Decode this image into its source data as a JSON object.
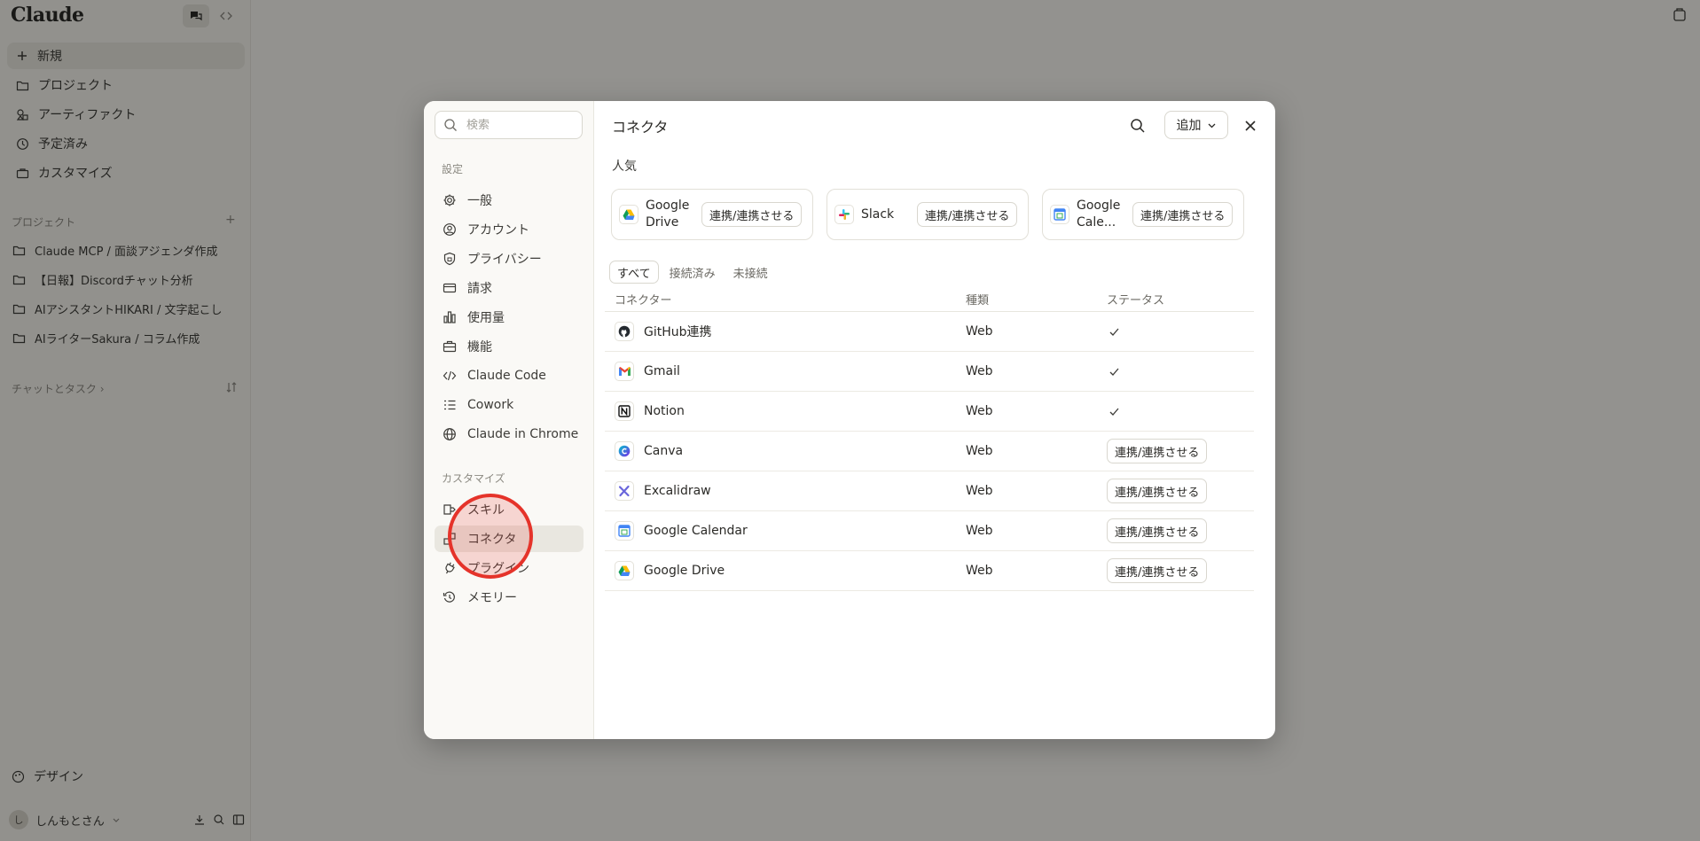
{
  "app": {
    "logo": "Claude",
    "nav": [
      {
        "label": "新規",
        "icon": "plus-icon"
      },
      {
        "label": "プロジェクト",
        "icon": "folder-icon"
      },
      {
        "label": "アーティファクト",
        "icon": "artifact-icon"
      },
      {
        "label": "予定済み",
        "icon": "clock-icon"
      },
      {
        "label": "カスタマイズ",
        "icon": "briefcase-icon"
      }
    ],
    "projects_label": "プロジェクト",
    "projects": [
      "Claude MCP / 面談アジェンダ作成",
      "【日報】Discordチャット分析",
      "AIアシスタントHIKARI / 文字起こし",
      "AIライターSakura / コラム作成"
    ],
    "chats_label": "チャットとタスク ›",
    "design_label": "デザイン",
    "user_name": "しんもとさん"
  },
  "modal": {
    "search_placeholder": "検索",
    "settings_label": "設定",
    "settings_items": [
      {
        "label": "一般",
        "icon": "gear-icon"
      },
      {
        "label": "アカウント",
        "icon": "user-circle-icon"
      },
      {
        "label": "プライバシー",
        "icon": "shield-icon"
      },
      {
        "label": "請求",
        "icon": "credit-card-icon"
      },
      {
        "label": "使用量",
        "icon": "bar-chart-icon"
      },
      {
        "label": "機能",
        "icon": "toolbox-icon"
      },
      {
        "label": "Claude Code",
        "icon": "code-icon"
      },
      {
        "label": "Cowork",
        "icon": "checklist-icon"
      },
      {
        "label": "Claude in Chrome",
        "icon": "globe-icon"
      }
    ],
    "customize_label": "カスタマイズ",
    "customize_items": [
      {
        "label": "スキル",
        "icon": "skill-icon"
      },
      {
        "label": "コネクタ",
        "icon": "connector-icon"
      },
      {
        "label": "プラグイン",
        "icon": "plug-icon"
      },
      {
        "label": "メモリー",
        "icon": "memory-icon"
      }
    ],
    "title": "コネクタ",
    "add_label": "追加",
    "popular_label": "人気",
    "connect_label": "連携/連携させる",
    "popular": [
      {
        "name": "Google Drive",
        "icon": "google-drive-icon"
      },
      {
        "name": "Slack",
        "icon": "slack-icon"
      },
      {
        "name": "Google Cale...",
        "icon": "google-calendar-icon"
      }
    ],
    "tabs": [
      "すべて",
      "接続済み",
      "未接続"
    ],
    "columns": [
      "コネクター",
      "種類",
      "ステータス"
    ],
    "rows": [
      {
        "name": "GitHub連携",
        "type": "Web",
        "connected": true,
        "icon": "github-icon"
      },
      {
        "name": "Gmail",
        "type": "Web",
        "connected": true,
        "icon": "gmail-icon"
      },
      {
        "name": "Notion",
        "type": "Web",
        "connected": true,
        "icon": "notion-icon"
      },
      {
        "name": "Canva",
        "type": "Web",
        "connected": false,
        "icon": "canva-icon"
      },
      {
        "name": "Excalidraw",
        "type": "Web",
        "connected": false,
        "icon": "excalidraw-icon"
      },
      {
        "name": "Google Calendar",
        "type": "Web",
        "connected": false,
        "icon": "google-calendar-icon"
      },
      {
        "name": "Google Drive",
        "type": "Web",
        "connected": false,
        "icon": "google-drive-icon"
      }
    ]
  }
}
